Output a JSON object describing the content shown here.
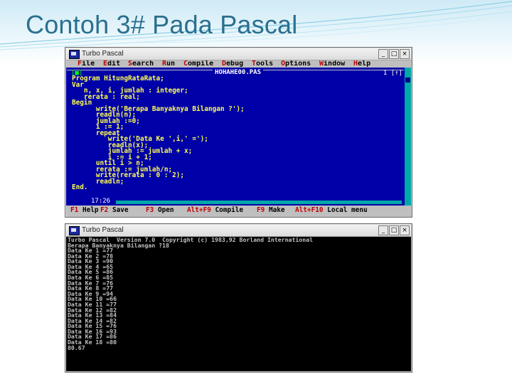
{
  "slide": {
    "title": "Contoh 3# Pada Pascal"
  },
  "editor_window": {
    "title": "Turbo Pascal",
    "menu": [
      "File",
      "Edit",
      "Search",
      "Run",
      "Compile",
      "Debug",
      "Tools",
      "Options",
      "Window",
      "Help"
    ],
    "file_name": "HOHAHE00.PAS",
    "window_number": "1 [↑]",
    "close_mark": "[■]",
    "code": "Program HitungRataRata;\nVar\n   n, x, i, jumlah : integer;\n   rerata : real;\nBegin\n      write('Berapa Banyaknya Bilangan ?');\n      readln(n);\n      jumlah :=0;\n      i := 1;\n      repeat\n         write('Data Ke ',i,' =');\n         readln(x);\n         jumlah := jumlah + x;\n         i := i + 1;\n      until i > n;\n      rerata := jumlah/n;\n      write(rerata : 0 : 2);\n      readln;\nEnd.",
    "cursor_position": "17:26",
    "status_items": [
      {
        "key": "F1",
        "label": "Help"
      },
      {
        "key": "F2",
        "label": "Save"
      },
      {
        "key": "F3",
        "label": "Open"
      },
      {
        "key": "Alt+F9",
        "label": "Compile"
      },
      {
        "key": "F9",
        "label": "Make"
      },
      {
        "key": "Alt+F10",
        "label": "Local menu"
      }
    ]
  },
  "output_window": {
    "title": "Turbo Pascal",
    "lines": [
      "Turbo Pascal  Version 7.0  Copyright (c) 1983,92 Borland International",
      "Berapa Banyaknya Bilangan ?18",
      "Data Ke 1 =77",
      "Data Ke 2 =78",
      "Data Ke 3 =90",
      "Data Ke 4 =65",
      "Data Ke 5 =86",
      "Data Ke 6 =85",
      "Data Ke 7 =76",
      "Data Ke 8 =77",
      "Data Ke 9 =94",
      "Data Ke 10 =66",
      "Data Ke 11 =77",
      "Data Ke 12 =82",
      "Data Ke 13 =84",
      "Data Ke 14 =82",
      "Data Ke 15 =76",
      "Data Ke 16 =93",
      "Data Ke 17 =86",
      "Data Ke 18 =80",
      "80.67"
    ]
  },
  "window_buttons": {
    "minimize": "_",
    "maximize": "□",
    "close": "×"
  },
  "colors": {
    "title_text": "#2a6f8f",
    "editor_background": "#0000a8",
    "code_text": "#ffff55",
    "console_background": "#000000",
    "console_text": "#c0c0c0"
  }
}
